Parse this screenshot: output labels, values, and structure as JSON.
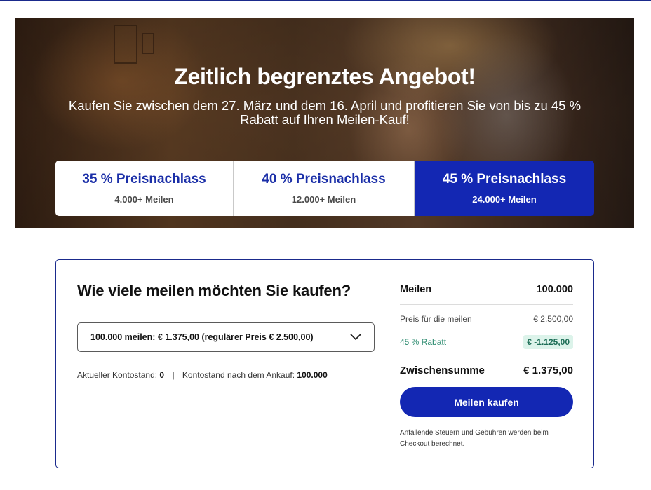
{
  "hero": {
    "title": "Zeitlich begrenztes Angebot!",
    "subtitle": "Kaufen Sie zwischen dem 27. März und dem 16. April und profitieren Sie von bis zu 45 % Rabatt auf Ihren Meilen-Kauf!",
    "tiers": [
      {
        "title": "35 % Preisnachlass",
        "subtitle": "4.000+ Meilen",
        "active": false
      },
      {
        "title": "40 % Preisnachlass",
        "subtitle": "12.000+ Meilen",
        "active": false
      },
      {
        "title": "45 % Preisnachlass",
        "subtitle": "24.000+ Meilen",
        "active": true
      }
    ]
  },
  "purchase": {
    "question": "Wie viele meilen möchten Sie kaufen?",
    "selected_option": "100.000 meilen: € 1.375,00 (regulärer Preis € 2.500,00)",
    "current_balance_label": "Aktueller Kontostand:",
    "current_balance_value": "0",
    "separator": "|",
    "after_balance_label": "Kontostand nach dem Ankauf:",
    "after_balance_value": "100.000"
  },
  "summary": {
    "miles_label": "Meilen",
    "miles_value": "100.000",
    "price_label": "Preis für die meilen",
    "price_value": "€ 2.500,00",
    "discount_label": "45 % Rabatt",
    "discount_value": "€ -1.125,00",
    "subtotal_label": "Zwischensumme",
    "subtotal_value": "€ 1.375,00",
    "buy_button": "Meilen kaufen",
    "note": "Anfallende Steuern und Gebühren werden beim Checkout berechnet."
  },
  "colors": {
    "brand_blue": "#1327b3",
    "discount_green": "#2a8a6e",
    "discount_badge_bg": "#dcf3ea"
  },
  "icons": {
    "dropdown": "chevron-down-icon"
  }
}
